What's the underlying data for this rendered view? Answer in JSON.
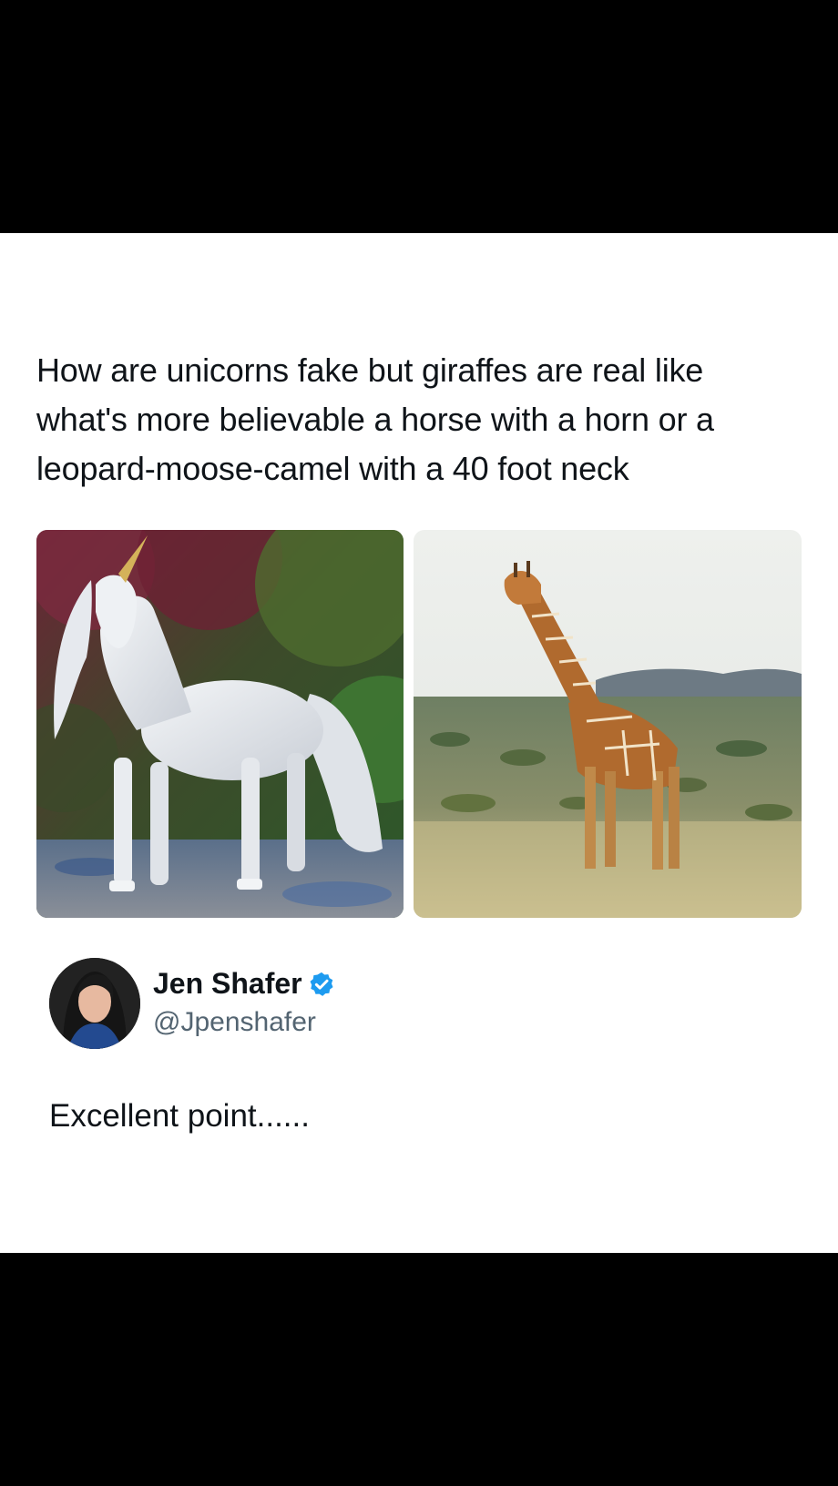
{
  "post": {
    "text": "How are unicorns fake but giraffes are real like what's more believable a horse with a horn or a leopard-moose-camel with a 40 foot neck",
    "images": [
      {
        "icon": "unicorn-photo"
      },
      {
        "icon": "giraffe-photo"
      }
    ]
  },
  "reply_author": {
    "name": "Jen Shafer",
    "handle": "@Jpenshafer",
    "verified_badge_color": "#1d9bf0"
  },
  "reply": {
    "text": "Excellent point......"
  },
  "colors": {
    "text_primary": "#0f1419",
    "text_secondary": "#536471",
    "background": "#ffffff",
    "letterbox": "#000000"
  }
}
